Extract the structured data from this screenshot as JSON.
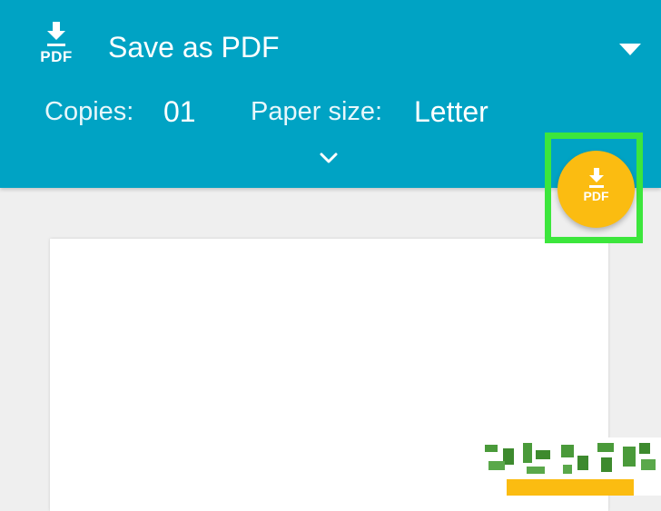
{
  "header": {
    "logo_text": "PDF",
    "title": "Save as PDF"
  },
  "settings": {
    "copies_label": "Copies:",
    "copies_value": "01",
    "paper_size_label": "Paper size:",
    "paper_size_value": "Letter"
  },
  "fab": {
    "icon": "download-pdf-icon",
    "text": "PDF"
  },
  "colors": {
    "header_bg": "#00a3c4",
    "fab_bg": "#fbbc11",
    "highlight": "#3ce63c",
    "background": "#efefef"
  }
}
